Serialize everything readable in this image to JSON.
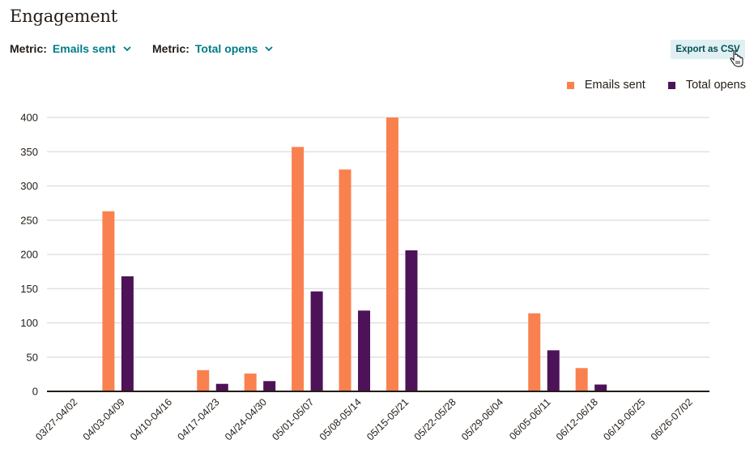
{
  "header": {
    "title": "Engagement",
    "export_label": "Export as CSV"
  },
  "metrics": [
    {
      "label": "Metric:",
      "value": "Emails sent",
      "icon": "chevron-down-icon"
    },
    {
      "label": "Metric:",
      "value": "Total opens",
      "icon": "chevron-down-icon"
    }
  ],
  "colors": {
    "emails_sent": "#f9814f",
    "total_opens": "#4d1257",
    "accent": "#007c89",
    "export_bg": "#e0f0f2"
  },
  "chart_data": {
    "type": "bar",
    "title": "",
    "xlabel": "",
    "ylabel": "",
    "ylim": [
      0,
      400
    ],
    "yticks": [
      0,
      50,
      100,
      150,
      200,
      250,
      300,
      350,
      400
    ],
    "grid": true,
    "legend_position": "top-right",
    "categories": [
      "03/27-04/02",
      "04/03-04/09",
      "04/10-04/16",
      "04/17-04/23",
      "04/24-04/30",
      "05/01-05/07",
      "05/08-05/14",
      "05/15-05/21",
      "05/22-05/28",
      "05/29-06/04",
      "06/05-06/11",
      "06/12-06/18",
      "06/19-06/25",
      "06/26-07/02"
    ],
    "series": [
      {
        "name": "Emails sent",
        "color": "#f9814f",
        "values": [
          0,
          263,
          0,
          31,
          26,
          357,
          324,
          400,
          0,
          0,
          114,
          34,
          0,
          0
        ]
      },
      {
        "name": "Total opens",
        "color": "#4d1257",
        "values": [
          0,
          168,
          0,
          11,
          15,
          146,
          118,
          206,
          0,
          0,
          60,
          10,
          0,
          0
        ]
      }
    ]
  }
}
